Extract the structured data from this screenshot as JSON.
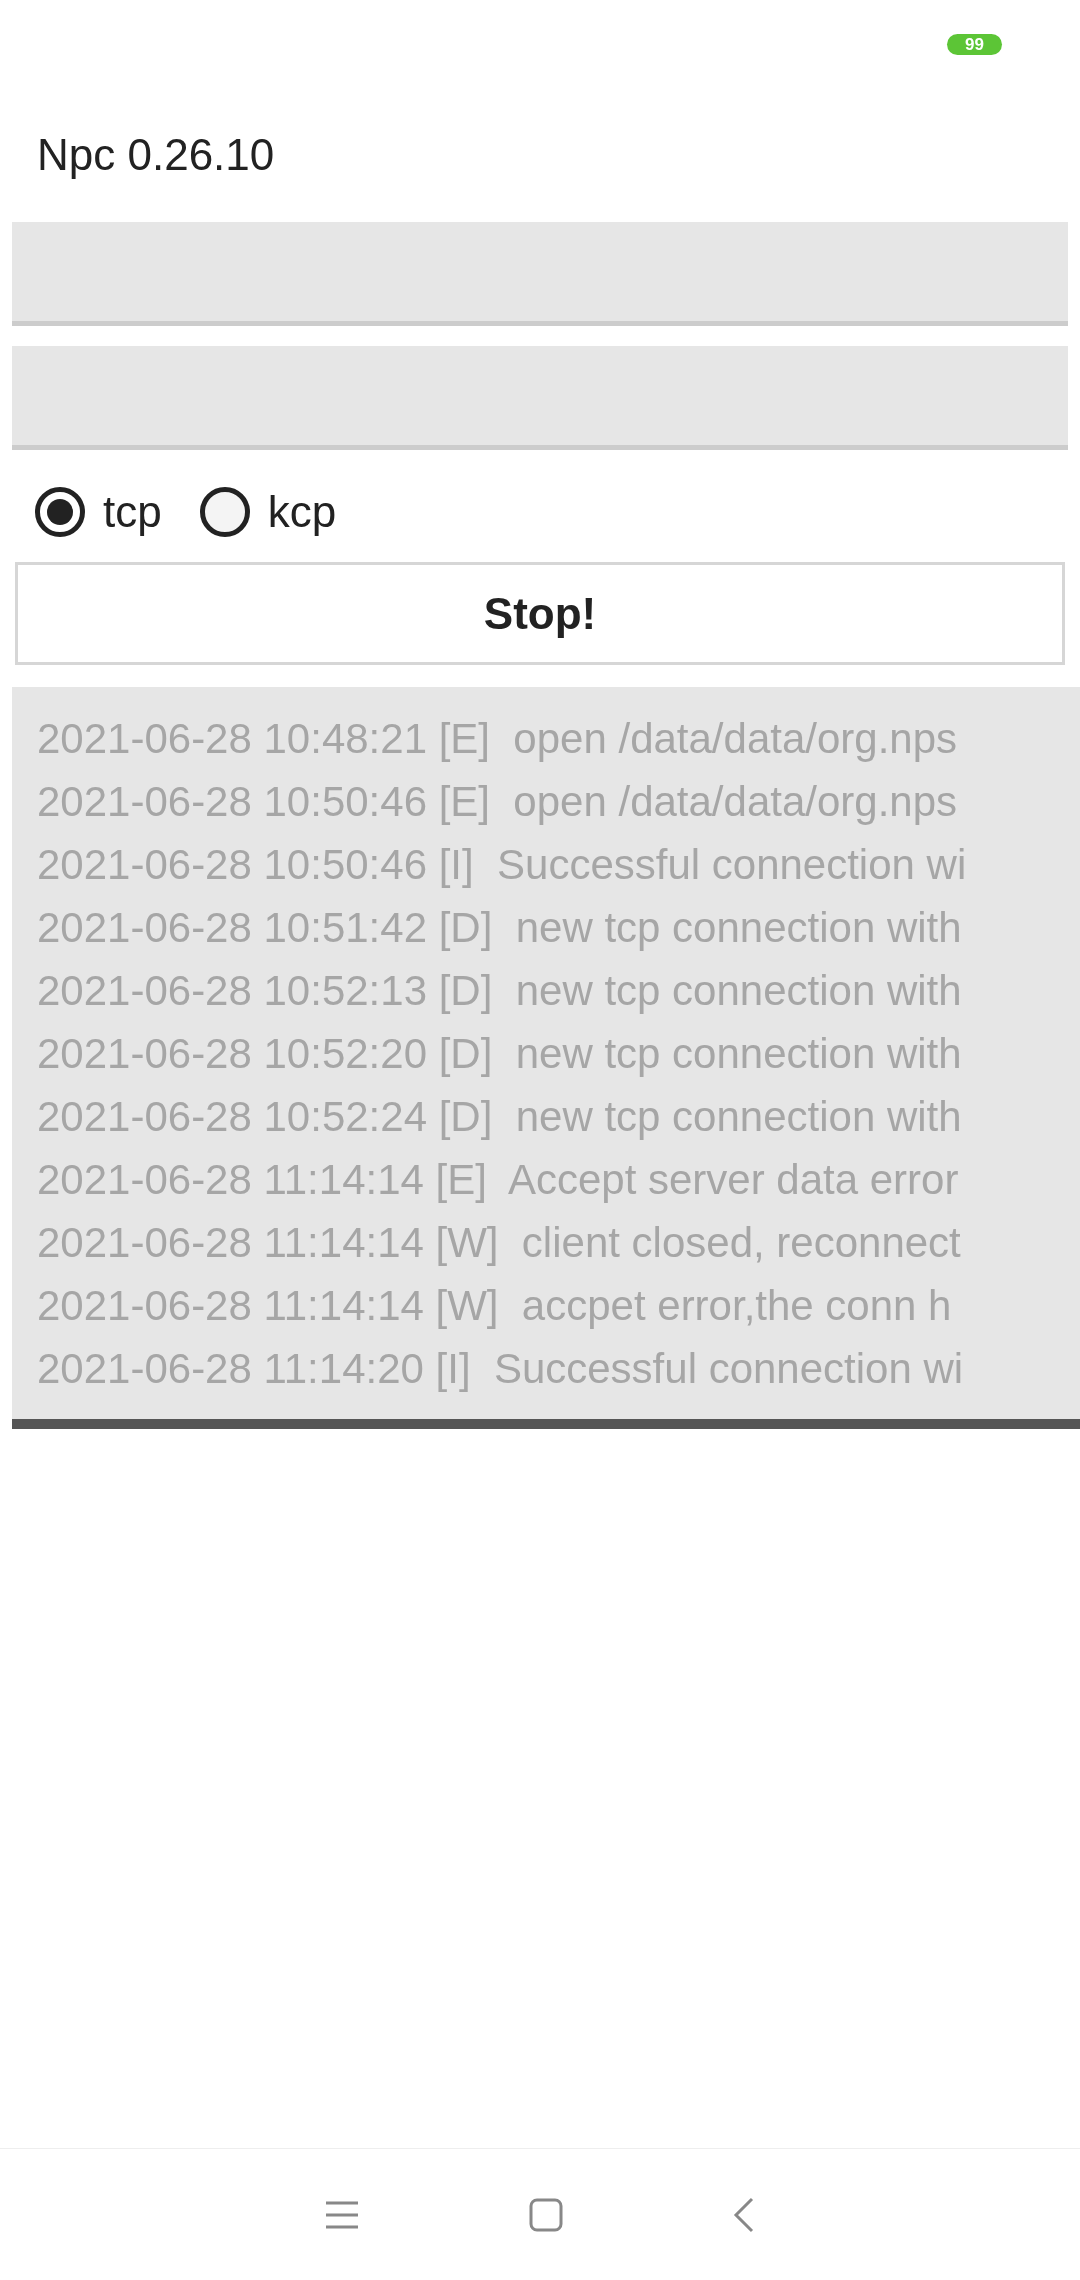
{
  "status_bar": {
    "battery": "99"
  },
  "title": "Npc 0.26.10",
  "fields": [
    {
      "kind": "text"
    },
    {
      "kind": "text"
    }
  ],
  "protocols": [
    {
      "label": "tcp",
      "selected": true
    },
    {
      "label": "kcp",
      "selected": false
    }
  ],
  "action_button": "Stop!",
  "log_lines": [
    "2021-06-28 10:48:21 [E]  open /data/data/org.nps",
    "2021-06-28 10:50:46 [E]  open /data/data/org.nps",
    "2021-06-28 10:50:46 [I]  Successful connection wi",
    "2021-06-28 10:51:42 [D]  new tcp connection with",
    "2021-06-28 10:52:13 [D]  new tcp connection with",
    "2021-06-28 10:52:20 [D]  new tcp connection with",
    "2021-06-28 10:52:24 [D]  new tcp connection with",
    "2021-06-28 11:14:14 [E]  Accept server data error",
    "2021-06-28 11:14:14 [W]  client closed, reconnect",
    "2021-06-28 11:14:14 [W]  accpet error,the conn h",
    "2021-06-28 11:14:20 [I]  Successful connection wi"
  ]
}
